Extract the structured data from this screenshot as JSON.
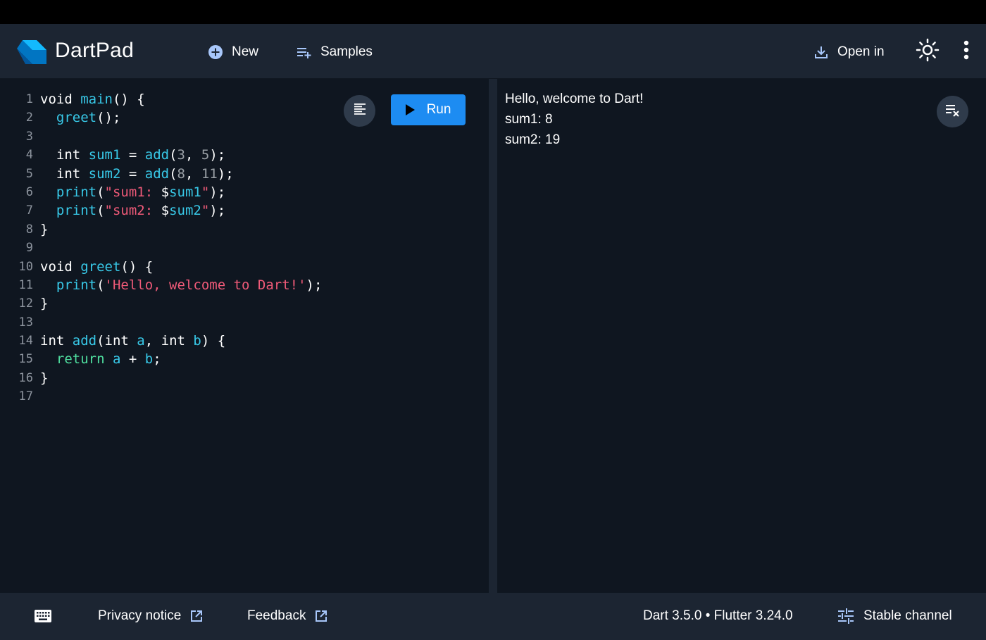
{
  "header": {
    "brand": "DartPad",
    "new_label": "New",
    "samples_label": "Samples",
    "open_in_label": "Open in"
  },
  "editor": {
    "run_label": "Run",
    "lines": [
      {
        "n": "1"
      },
      {
        "n": "2"
      },
      {
        "n": "3"
      },
      {
        "n": "4"
      },
      {
        "n": "5"
      },
      {
        "n": "6"
      },
      {
        "n": "7"
      },
      {
        "n": "8"
      },
      {
        "n": "9"
      },
      {
        "n": "10"
      },
      {
        "n": "11"
      },
      {
        "n": "12"
      },
      {
        "n": "13"
      },
      {
        "n": "14"
      },
      {
        "n": "15"
      },
      {
        "n": "16"
      },
      {
        "n": "17"
      }
    ],
    "code": {
      "l1_void": "void ",
      "l1_main": "main",
      "l1_rest": "() {",
      "l2_greet": "greet",
      "l2_rest": "();",
      "l4_int": "int ",
      "l4_var": "sum1",
      "l4_eq": " = ",
      "l4_add": "add",
      "l4_p1": "(",
      "l4_a": "3",
      "l4_c": ", ",
      "l4_b": "5",
      "l4_end": ");",
      "l5_int": "int ",
      "l5_var": "sum2",
      "l5_eq": " = ",
      "l5_add": "add",
      "l5_p1": "(",
      "l5_a": "8",
      "l5_c": ", ",
      "l5_b": "11",
      "l5_end": ");",
      "l6_print": "print",
      "l6_p1": "(",
      "l6_str": "\"sum1: ",
      "l6_dollar": "$",
      "l6_var": "sum1",
      "l6_q": "\"",
      "l6_end": ");",
      "l7_print": "print",
      "l7_p1": "(",
      "l7_str": "\"sum2: ",
      "l7_dollar": "$",
      "l7_var": "sum2",
      "l7_q": "\"",
      "l7_end": ");",
      "l8": "}",
      "l10_void": "void ",
      "l10_greet": "greet",
      "l10_rest": "() {",
      "l11_print": "print",
      "l11_p1": "(",
      "l11_str": "'Hello, welcome to Dart!'",
      "l11_end": ");",
      "l12": "}",
      "l14_int": "int ",
      "l14_add": "add",
      "l14_p1": "(int ",
      "l14_a": "a",
      "l14_c": ", int ",
      "l14_b": "b",
      "l14_end": ") {",
      "l15_ret": "return ",
      "l15_a": "a",
      "l15_plus": " + ",
      "l15_b": "b",
      "l15_end": ";",
      "l16": "}"
    }
  },
  "output": {
    "lines": [
      "Hello, welcome to Dart!",
      "sum1: 8",
      "sum2: 19"
    ]
  },
  "footer": {
    "privacy_label": "Privacy notice",
    "feedback_label": "Feedback",
    "version_label": "Dart 3.5.0 • Flutter 3.24.0",
    "channel_label": "Stable channel"
  },
  "colors": {
    "accent": "#1d8cf2",
    "header_bg": "#1c2532",
    "panel_bg": "#0f1620",
    "function": "#38c9e8",
    "string": "#ef5a78",
    "keyword_return": "#4fe0a0"
  },
  "icons": [
    "dart-logo-icon",
    "plus-circle-icon",
    "playlist-add-icon",
    "download-icon",
    "brightness-icon",
    "more-vert-icon",
    "format-align-icon",
    "play-icon",
    "clear-output-icon",
    "keyboard-icon",
    "open-in-new-icon",
    "tune-icon"
  ]
}
